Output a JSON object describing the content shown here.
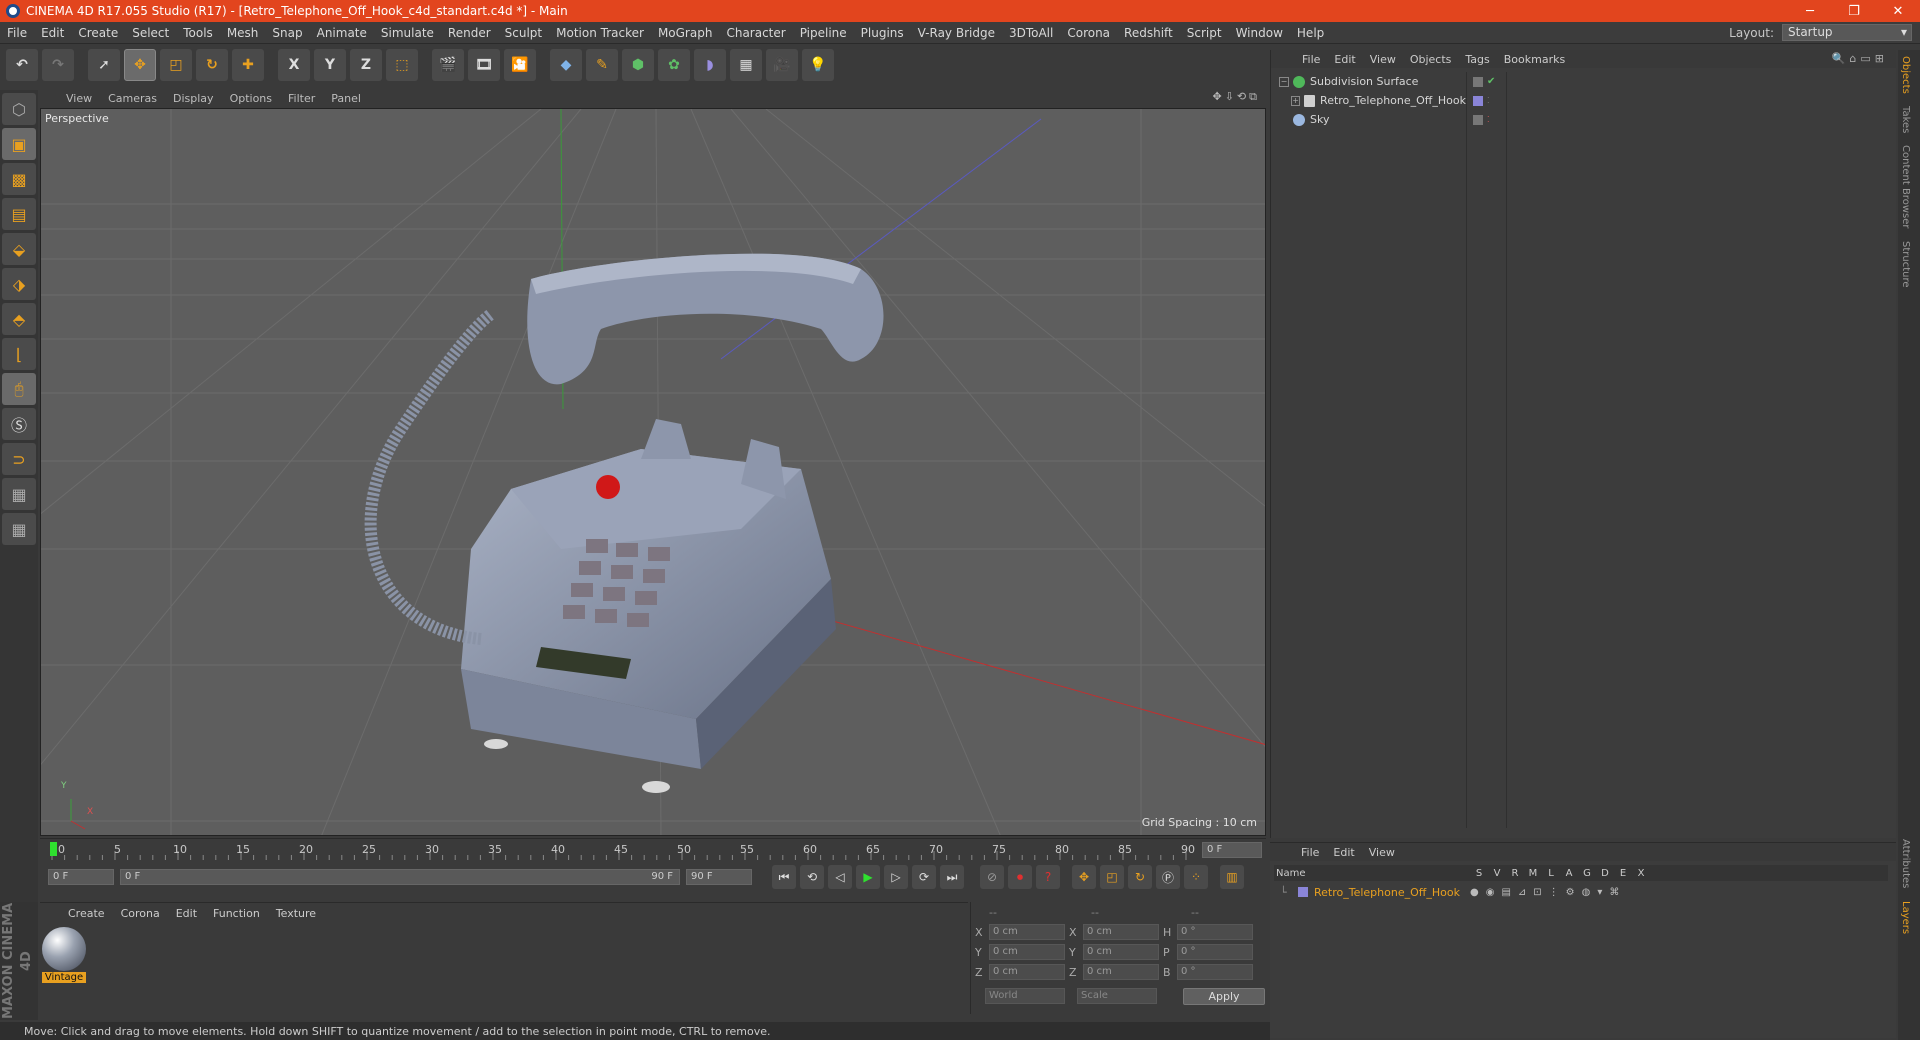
{
  "window": {
    "title": "CINEMA 4D R17.055 Studio (R17) - [Retro_Telephone_Off_Hook_c4d_standart.c4d *] - Main",
    "controls": [
      "─",
      "❐",
      "✕"
    ]
  },
  "menu": [
    "File",
    "Edit",
    "Create",
    "Select",
    "Tools",
    "Mesh",
    "Snap",
    "Animate",
    "Simulate",
    "Render",
    "Sculpt",
    "Motion Tracker",
    "MoGraph",
    "Character",
    "Pipeline",
    "Plugins",
    "V-Ray Bridge",
    "3DToAll",
    "Corona",
    "Redshift",
    "Script",
    "Window",
    "Help"
  ],
  "layout": {
    "label": "Layout:",
    "value": "Startup"
  },
  "toolbar": {
    "axis_x": "X",
    "axis_y": "Y",
    "axis_z": "Z"
  },
  "viewport": {
    "menu": [
      "View",
      "Cameras",
      "Display",
      "Options",
      "Filter",
      "Panel"
    ],
    "label": "Perspective",
    "grid_spacing": "Grid Spacing : 10 cm",
    "axis_x": "X",
    "axis_y": "Y"
  },
  "object_manager": {
    "menu": [
      "File",
      "Edit",
      "View",
      "Objects",
      "Tags",
      "Bookmarks"
    ],
    "objects": [
      {
        "name": "Subdivision Surface",
        "icon_color": "#4fb85a"
      },
      {
        "name": "Retro_Telephone_Off_Hook",
        "icon_color": "#cfcfcf"
      },
      {
        "name": "Sky",
        "icon_color": "#9bb8e0"
      }
    ]
  },
  "side_tabs": [
    "Objects",
    "Takes",
    "Content Browser",
    "Structure"
  ],
  "side_tabs_lower": [
    "Attributes",
    "Layers"
  ],
  "timeline": {
    "ticks": [
      "0",
      "5",
      "10",
      "15",
      "20",
      "25",
      "30",
      "35",
      "40",
      "45",
      "50",
      "55",
      "60",
      "65",
      "70",
      "75",
      "80",
      "85",
      "90"
    ],
    "current_frame": "0 F",
    "start": "0 F",
    "slider_start": "0 F",
    "slider_end": "90 F",
    "end": "90 F"
  },
  "material_manager": {
    "menu": [
      "Create",
      "Corona",
      "Edit",
      "Function",
      "Texture"
    ],
    "materials": [
      {
        "name": "Vintage"
      }
    ]
  },
  "coordinates": {
    "headers": [
      "--",
      "--",
      "--"
    ],
    "rows": [
      {
        "l1": "X",
        "v1": "0 cm",
        "l2": "X",
        "v2": "0 cm",
        "l3": "H",
        "v3": "0 °"
      },
      {
        "l1": "Y",
        "v1": "0 cm",
        "l2": "Y",
        "v2": "0 cm",
        "l3": "P",
        "v3": "0 °"
      },
      {
        "l1": "Z",
        "v1": "0 cm",
        "l2": "Z",
        "v2": "0 cm",
        "l3": "B",
        "v3": "0 °"
      }
    ],
    "space": "World",
    "mode": "Scale",
    "apply": "Apply"
  },
  "layers_manager": {
    "menu": [
      "File",
      "Edit",
      "View"
    ],
    "name_header": "Name",
    "columns": [
      "S",
      "V",
      "R",
      "M",
      "L",
      "A",
      "G",
      "D",
      "E",
      "X"
    ],
    "rows": [
      {
        "name": "Retro_Telephone_Off_Hook",
        "color": "#e8a020"
      }
    ]
  },
  "status": "Move: Click and drag to move elements. Hold down SHIFT to quantize movement / add to the selection in point mode, CTRL to remove.",
  "branding": "MAXON CINEMA 4D"
}
